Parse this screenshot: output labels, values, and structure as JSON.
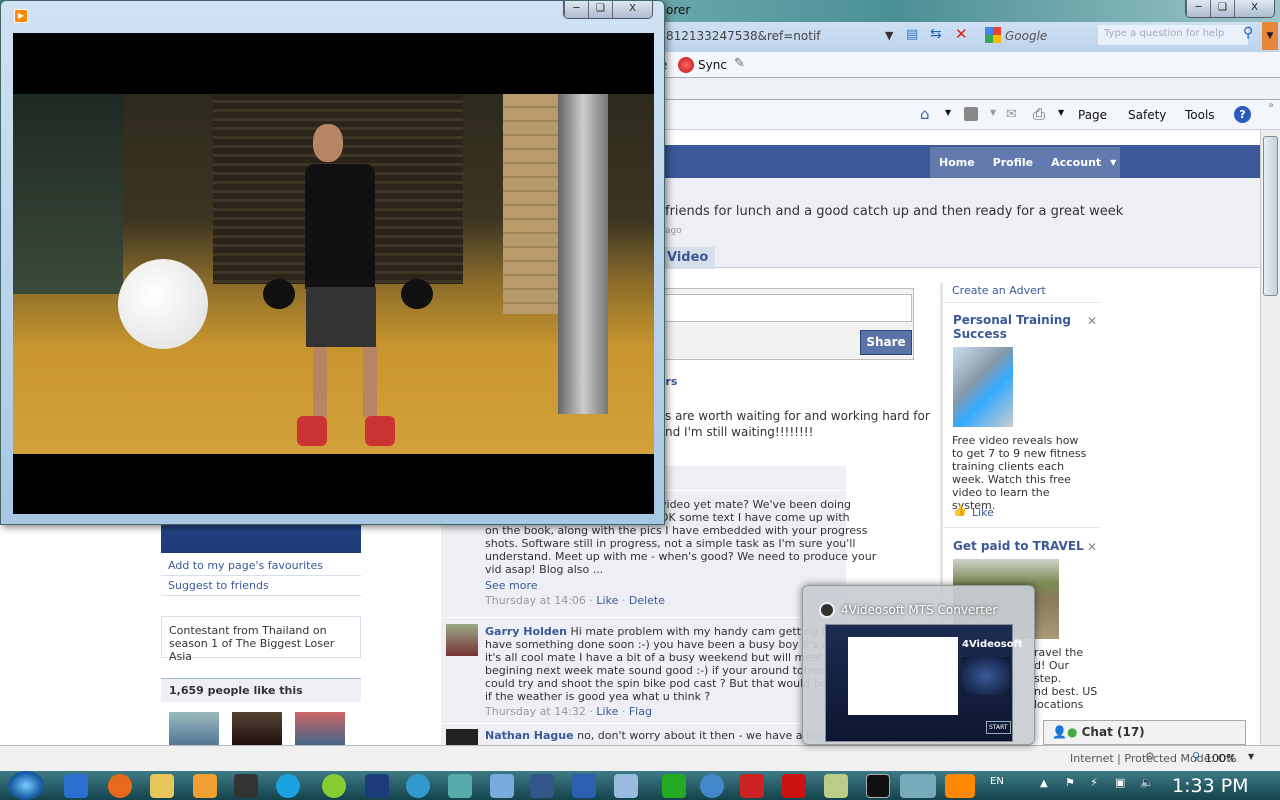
{
  "browser": {
    "title_fragment": "orer",
    "url_fragment": "812133247538&ref=notif",
    "search_engine": "Google",
    "help_placeholder": "Type a question for help",
    "toolbar_sync": "Sync",
    "toolbar_fragment": "e",
    "command_bar": [
      "Page",
      "Safety",
      "Tools"
    ],
    "status_zone": "Internet | Protected Mode: Off",
    "zoom": "100%"
  },
  "facebook": {
    "nav": [
      "Home",
      "Profile",
      "Account"
    ],
    "status_text": "friends for lunch and a good catch up and then ready for a great week",
    "status_time": "ago",
    "tab_video": "Video",
    "share_button": "Share",
    "left": {
      "links": [
        "Add to my page's favourites",
        "Suggest to friends"
      ],
      "bio": "Contestant from Thailand on season 1 of The Biggest Loser Asia",
      "likes_count": "1,659 people like this"
    },
    "wall_fragment_link": "ers",
    "wall_fragment_text": [
      "s are worth waiting for and working hard for",
      "nd I'm still waiting!!!!!!!!"
    ],
    "comments": [
      {
        "author": "",
        "text_lines": [
          "video yet mate? We've been doing",
          "DK some text I have come up with",
          "on the book, along with the pics I have embedded with your progress",
          "shots. Software still in progress, not a simple task as I'm sure you'll",
          "understand. Meet up with me - when's good? We need to produce your",
          "vid asap! Blog also ..."
        ],
        "see_more": "See more",
        "time": "Thursday at 14:06",
        "actions": [
          "Like",
          "Delete"
        ]
      },
      {
        "author": "Garry Holden",
        "text_lines": [
          "Hi mate problem with my handy cam getting fixed.",
          "have something done soon :-) you have been a busy boy it's all go",
          "it's all cool mate I have a bit of a busy weekend but will meet othe",
          "begining next week mate sound good :-) if your around tomorrow",
          "could try and shoot the spin bike pod cast ? But that would be at n",
          "if the weather is good yea what u think ?"
        ],
        "time": "Thursday at 14:32",
        "actions": [
          "Like",
          "Flag"
        ]
      },
      {
        "author": "Nathan Hague",
        "text_lines": [
          "no, don't worry about it then - we have a brand"
        ]
      }
    ],
    "ads": {
      "create": "Create an Advert",
      "items": [
        {
          "title": "Personal Training Success",
          "body": "Free video reveals how to get 7 to 9 new fitness training clients each week. Watch this free video to learn the system.",
          "like": "Like"
        },
        {
          "title": "Get paid to TRAVEL",
          "body_lines": [
            "ravel the",
            "d! Our",
            "step.",
            "nd best. US",
            "locations"
          ]
        }
      ]
    },
    "chat": "Chat (17)"
  },
  "thumbnail_popup": {
    "title": "4Videosoft MTS Converter",
    "brand": "4Videosoft",
    "start": "START"
  },
  "taskbar": {
    "language": "EN",
    "clock": "1:33 PM"
  }
}
